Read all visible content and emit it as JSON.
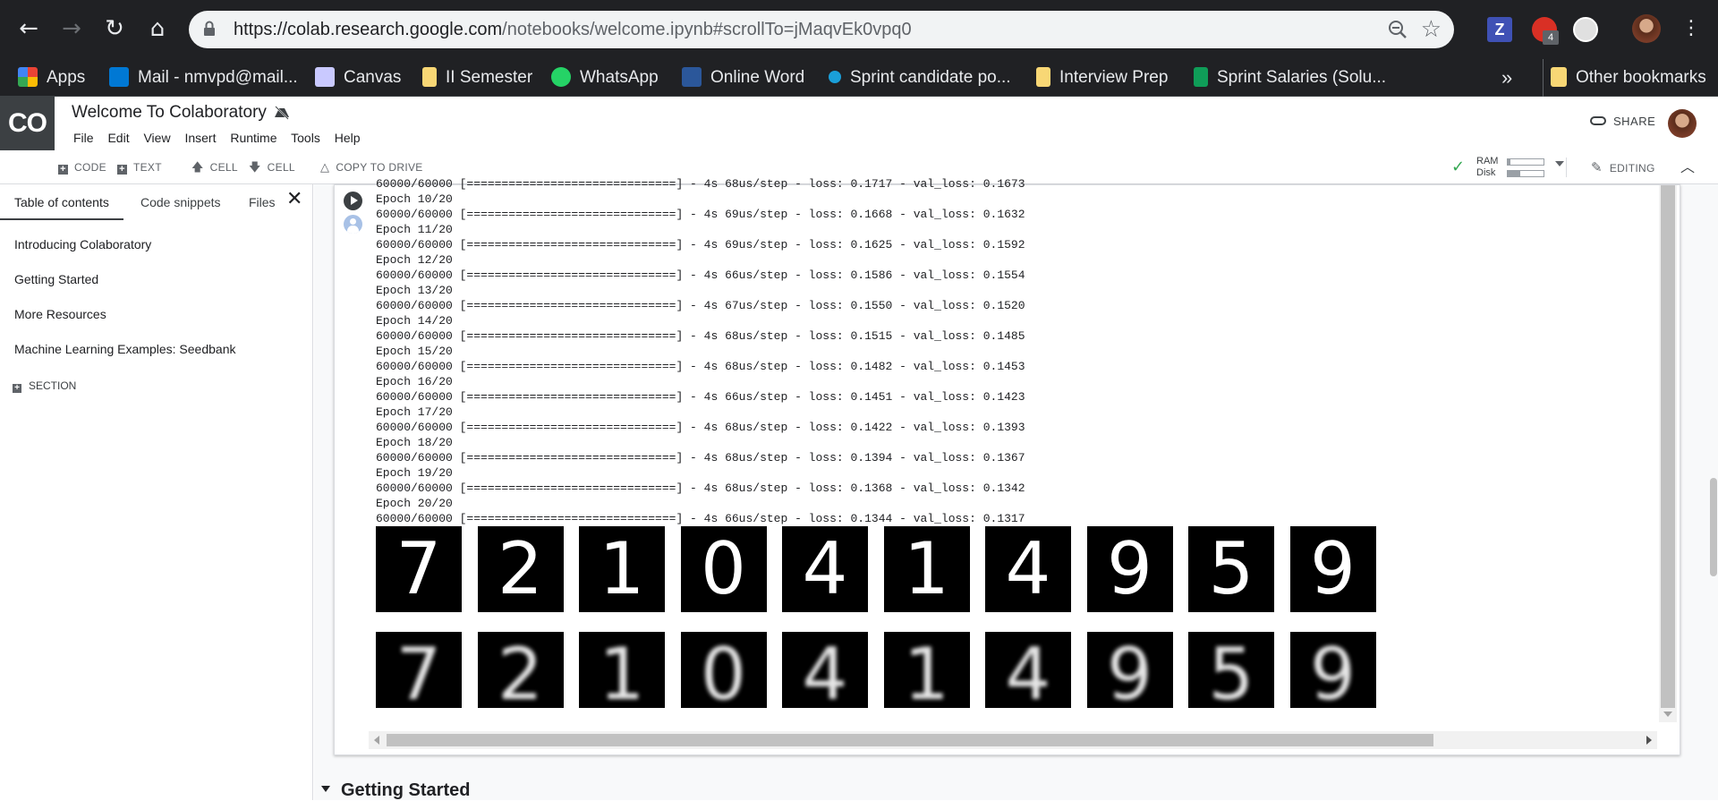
{
  "browser": {
    "url_host": "https://colab.research.google.com",
    "url_path": "/notebooks/welcome.ipynb#scrollTo=jMaqvEk0vpq0",
    "extension_badge": "4"
  },
  "bookmarks": [
    {
      "label": "Apps",
      "icon": "apps-grid-icon",
      "color": "#ea4335"
    },
    {
      "label": "Mail - nmvpd@mail...",
      "icon": "outlook-icon",
      "color": "#0078d4"
    },
    {
      "label": "Canvas",
      "icon": "canvas-icon",
      "color": "#e0e0ff"
    },
    {
      "label": "II Semester",
      "icon": "folder-icon",
      "color": "#f8d775"
    },
    {
      "label": "WhatsApp",
      "icon": "whatsapp-icon",
      "color": "#25d366"
    },
    {
      "label": "Online Word",
      "icon": "word-icon",
      "color": "#2b579a"
    },
    {
      "label": "Sprint candidate po...",
      "icon": "sprint-icon",
      "color": "#1a9fd9"
    },
    {
      "label": "Interview Prep",
      "icon": "folder-icon",
      "color": "#f8d775"
    },
    {
      "label": "Sprint Salaries (Solu...",
      "icon": "sheets-icon",
      "color": "#0f9d58"
    },
    {
      "label": "»",
      "icon": "",
      "color": ""
    },
    {
      "label": "Other bookmarks",
      "icon": "folder-icon",
      "color": "#f8d775"
    }
  ],
  "colab": {
    "logo": "CO",
    "title": "Welcome To Colaboratory",
    "menu": [
      "File",
      "Edit",
      "View",
      "Insert",
      "Runtime",
      "Tools",
      "Help"
    ],
    "share_label": "SHARE"
  },
  "toolbar": {
    "code_label": "CODE",
    "text_label": "TEXT",
    "cell_up_label": "CELL",
    "cell_down_label": "CELL",
    "copy_to_drive_label": "COPY TO DRIVE",
    "ram_label": "RAM",
    "disk_label": "Disk",
    "ram_usage": 0.08,
    "disk_usage": 0.35,
    "editing_label": "EDITING"
  },
  "sidebar": {
    "tabs": [
      "Table of contents",
      "Code snippets",
      "Files"
    ],
    "items": [
      "Introducing Colaboratory",
      "Getting Started",
      "More Resources",
      "Machine Learning Examples: Seedbank"
    ],
    "section_label": "SECTION"
  },
  "output": {
    "log_lines": [
      "60000/60000 [==============================] - 4s 68us/step - loss: 0.1717 - val_loss: 0.1673",
      "Epoch 10/20",
      "60000/60000 [==============================] - 4s 69us/step - loss: 0.1668 - val_loss: 0.1632",
      "Epoch 11/20",
      "60000/60000 [==============================] - 4s 69us/step - loss: 0.1625 - val_loss: 0.1592",
      "Epoch 12/20",
      "60000/60000 [==============================] - 4s 66us/step - loss: 0.1586 - val_loss: 0.1554",
      "Epoch 13/20",
      "60000/60000 [==============================] - 4s 67us/step - loss: 0.1550 - val_loss: 0.1520",
      "Epoch 14/20",
      "60000/60000 [==============================] - 4s 68us/step - loss: 0.1515 - val_loss: 0.1485",
      "Epoch 15/20",
      "60000/60000 [==============================] - 4s 68us/step - loss: 0.1482 - val_loss: 0.1453",
      "Epoch 16/20",
      "60000/60000 [==============================] - 4s 66us/step - loss: 0.1451 - val_loss: 0.1423",
      "Epoch 17/20",
      "60000/60000 [==============================] - 4s 68us/step - loss: 0.1422 - val_loss: 0.1393",
      "Epoch 18/20",
      "60000/60000 [==============================] - 4s 68us/step - loss: 0.1394 - val_loss: 0.1367",
      "Epoch 19/20",
      "60000/60000 [==============================] - 4s 68us/step - loss: 0.1368 - val_loss: 0.1342",
      "Epoch 20/20",
      "60000/60000 [==============================] - 4s 66us/step - loss: 0.1344 - val_loss: 0.1317"
    ],
    "original_digits": [
      "7",
      "2",
      "1",
      "0",
      "4",
      "1",
      "4",
      "9",
      "5",
      "9"
    ],
    "reconstructed_digits": [
      "7",
      "2",
      "1",
      "0",
      "4",
      "1",
      "4",
      "9",
      "5",
      "9"
    ]
  },
  "next_section": "Getting Started"
}
